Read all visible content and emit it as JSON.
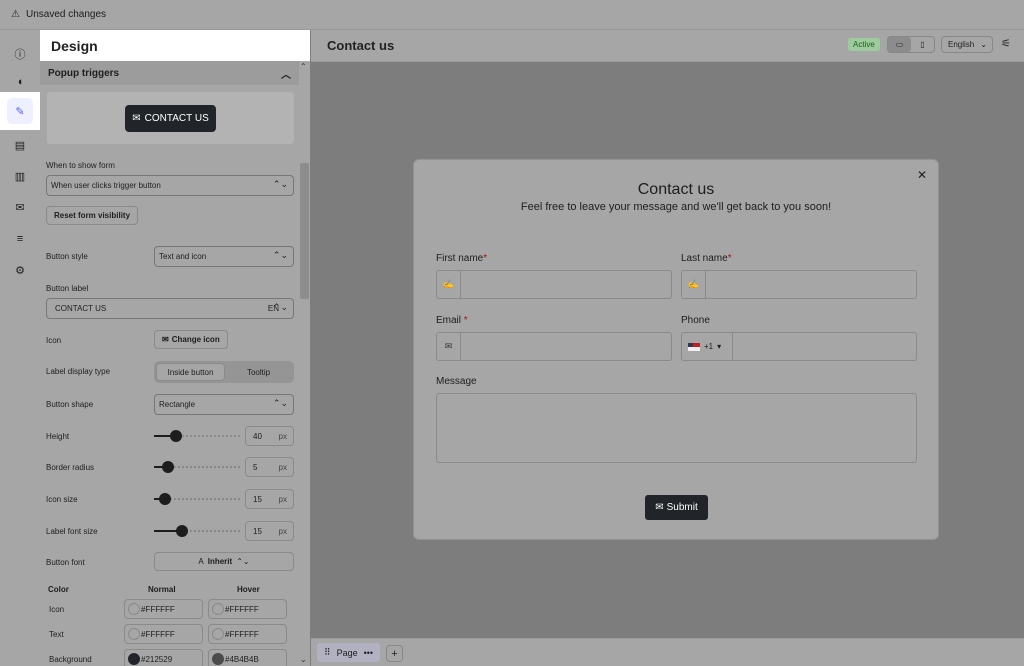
{
  "topbar": {
    "warning_icon": "warning-triangle-icon",
    "text": "Unsaved changes"
  },
  "rail": {
    "items": [
      {
        "name": "info-icon",
        "glyph": "ⓘ"
      },
      {
        "name": "megaphone-icon",
        "glyph": "📢"
      },
      {
        "name": "brush-icon",
        "glyph": "✎",
        "active": true
      },
      {
        "name": "form-icon",
        "glyph": "▤"
      },
      {
        "name": "book-icon",
        "glyph": "📖"
      },
      {
        "name": "mail-icon",
        "glyph": "✉"
      },
      {
        "name": "filter-icon",
        "glyph": "≡"
      },
      {
        "name": "gear-icon",
        "glyph": "⚙"
      }
    ]
  },
  "panel": {
    "title": "Design",
    "section_title": "Popup triggers",
    "preview_button_label": "CONTACT US",
    "when_to_show_label": "When to show form",
    "when_to_show_value": "When user clicks trigger button",
    "reset_button_label": "Reset form visibility",
    "button_style_label": "Button style",
    "button_style_value": "Text and icon",
    "button_label_label": "Button label",
    "button_label_value": "CONTACT US",
    "button_label_lang": "EN",
    "icon_label": "Icon",
    "change_icon_label": "Change icon",
    "label_display_type_label": "Label display type",
    "label_display_options": [
      "Inside button",
      "Tooltip"
    ],
    "button_shape_label": "Button shape",
    "button_shape_value": "Rectangle",
    "height_label": "Height",
    "height_value": "40",
    "height_fraction": 0.25,
    "border_radius_label": "Border radius",
    "border_radius_value": "5",
    "border_radius_fraction": 0.16,
    "icon_size_label": "Icon size",
    "icon_size_value": "15",
    "icon_size_fraction": 0.13,
    "label_font_size_label": "Label font size",
    "label_font_size_value": "15",
    "label_font_size_fraction": 0.32,
    "unit": "px",
    "button_font_label": "Button font",
    "button_font_value": "Inherit",
    "color_header": "Color",
    "normal_header": "Normal",
    "hover_header": "Hover",
    "color_rows": [
      {
        "label": "Icon",
        "normal": "#FFFFFF",
        "hover": "#FFFFFF"
      },
      {
        "label": "Text",
        "normal": "#FFFFFF",
        "hover": "#FFFFFF"
      },
      {
        "label": "Background",
        "normal": "#212529",
        "hover": "#4B4B4B"
      }
    ]
  },
  "main": {
    "title": "Contact us",
    "status_badge": "Active",
    "language": "English",
    "popup": {
      "title": "Contact us",
      "subtitle": "Feel free to leave your message and we'll get back to you soon!",
      "first_name_label": "First name",
      "last_name_label": "Last name",
      "email_label": "Email",
      "phone_label": "Phone",
      "phone_code": "+1",
      "message_label": "Message",
      "required_mark": "*",
      "submit_label": "Submit"
    }
  },
  "bottombar": {
    "page_tab_label": "Page",
    "page_tab_menu": "•••",
    "add_label": "+"
  }
}
